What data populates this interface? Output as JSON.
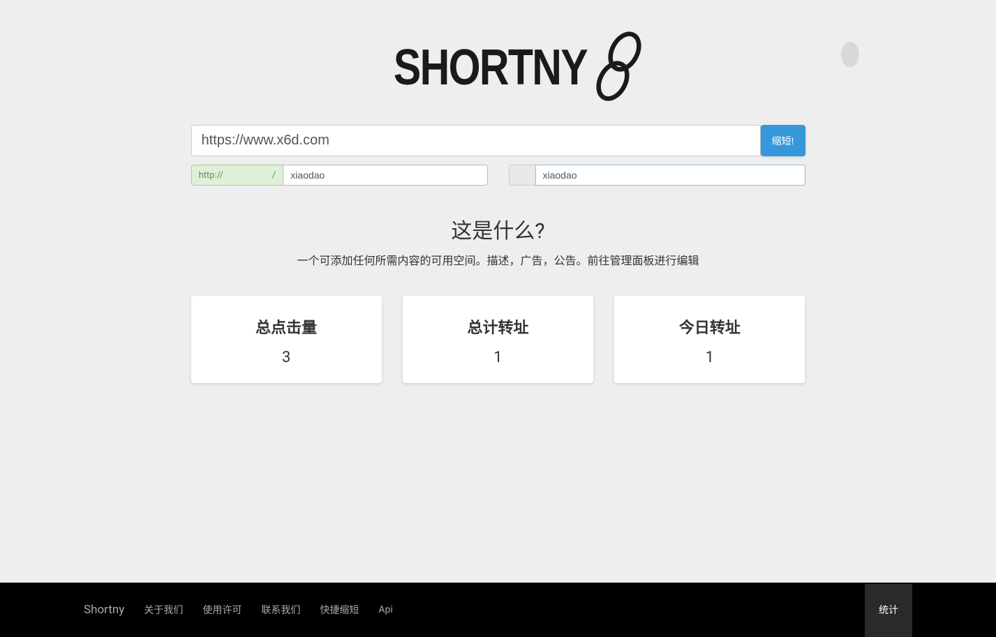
{
  "logo": {
    "text": "SHORTNY"
  },
  "urlInput": {
    "value": "https://www.x6d.com"
  },
  "shortenButton": {
    "label": "缩短!"
  },
  "aliasLeft": {
    "prefix": "http://",
    "suffix": "/",
    "value": "xiaodao"
  },
  "aliasRight": {
    "value": "xiaodao"
  },
  "whatis": {
    "title": "这是什么?",
    "description": "一个可添加任何所需内容的可用空间。描述，广告，公告。前往管理面板进行编辑"
  },
  "stats": {
    "card1": {
      "title": "总点击量",
      "value": "3"
    },
    "card2": {
      "title": "总计转址",
      "value": "1"
    },
    "card3": {
      "title": "今日转址",
      "value": "1"
    }
  },
  "footer": {
    "brand": "Shortny",
    "links": {
      "about": "关于我们",
      "license": "使用许可",
      "contact": "联系我们",
      "quickShorten": "快捷缩短",
      "api": "Api"
    },
    "statsButton": "统计"
  }
}
